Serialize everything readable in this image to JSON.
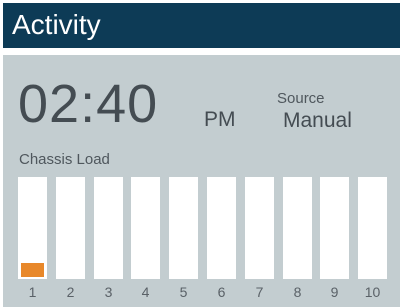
{
  "header": {
    "title": "Activity"
  },
  "clock": {
    "time": "02:40",
    "meridiem": "PM"
  },
  "source": {
    "label": "Source",
    "value": "Manual"
  },
  "chassis_load": {
    "label": "Chassis Load",
    "bars": [
      {
        "number": "1",
        "level": 0.14
      },
      {
        "number": "2",
        "level": 0
      },
      {
        "number": "3",
        "level": 0
      },
      {
        "number": "4",
        "level": 0
      },
      {
        "number": "5",
        "level": 0
      },
      {
        "number": "6",
        "level": 0
      },
      {
        "number": "7",
        "level": 0
      },
      {
        "number": "8",
        "level": 0
      },
      {
        "number": "9",
        "level": 0
      },
      {
        "number": "10",
        "level": 0
      }
    ]
  },
  "colors": {
    "header_bg": "#0d3b56",
    "panel_bg": "#c3cdd0",
    "bar_bg": "#ffffff",
    "load_fill": "#e8882a"
  }
}
